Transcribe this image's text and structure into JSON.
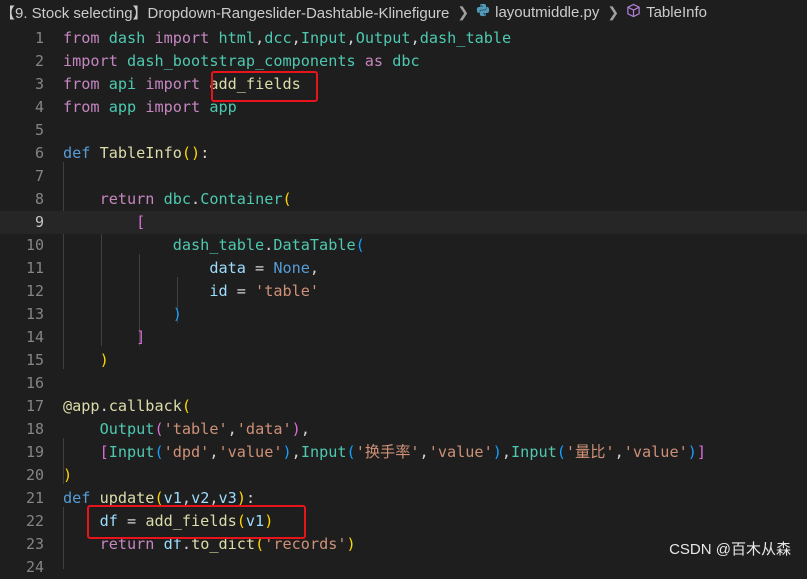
{
  "breadcrumb": {
    "folder": "【9. Stock selecting】Dropdown-Rangeslider-Dashtable-Klinefigure",
    "file": "layoutmiddle.py",
    "symbol": "TableInfo",
    "folder_icon": "folder",
    "file_icon": "python-file-icon",
    "symbol_icon": "symbol-method-cube-icon"
  },
  "editor": {
    "active_line": 9,
    "lines": [
      {
        "n": "1",
        "tokens": [
          [
            "kw",
            "from"
          ],
          [
            "t",
            " "
          ],
          [
            "cls",
            "dash"
          ],
          [
            "t",
            " "
          ],
          [
            "kw",
            "import"
          ],
          [
            "t",
            " "
          ],
          [
            "cls",
            "html"
          ],
          [
            "t",
            ","
          ],
          [
            "cls",
            "dcc"
          ],
          [
            "t",
            ","
          ],
          [
            "cls",
            "Input"
          ],
          [
            "t",
            ","
          ],
          [
            "cls",
            "Output"
          ],
          [
            "t",
            ","
          ],
          [
            "cls",
            "dash_table"
          ]
        ]
      },
      {
        "n": "2",
        "tokens": [
          [
            "kw",
            "import"
          ],
          [
            "t",
            " "
          ],
          [
            "cls",
            "dash_bootstrap_components"
          ],
          [
            "t",
            " "
          ],
          [
            "kw",
            "as"
          ],
          [
            "t",
            " "
          ],
          [
            "cls",
            "dbc"
          ]
        ]
      },
      {
        "n": "3",
        "tokens": [
          [
            "kw",
            "from"
          ],
          [
            "t",
            " "
          ],
          [
            "cls",
            "api"
          ],
          [
            "t",
            " "
          ],
          [
            "kw",
            "import"
          ],
          [
            "t",
            " "
          ],
          [
            "fn",
            "add_fields"
          ]
        ]
      },
      {
        "n": "4",
        "tokens": [
          [
            "kw",
            "from"
          ],
          [
            "t",
            " "
          ],
          [
            "cls",
            "app"
          ],
          [
            "t",
            " "
          ],
          [
            "kw",
            "import"
          ],
          [
            "t",
            " "
          ],
          [
            "cls",
            "app"
          ]
        ]
      },
      {
        "n": "5",
        "tokens": []
      },
      {
        "n": "6",
        "tokens": [
          [
            "kwb",
            "def"
          ],
          [
            "t",
            " "
          ],
          [
            "fn",
            "TableInfo"
          ],
          [
            "p1",
            "()"
          ],
          [
            "t",
            ":"
          ]
        ]
      },
      {
        "n": "7",
        "tokens": []
      },
      {
        "n": "8",
        "tokens": [
          [
            "t",
            "    "
          ],
          [
            "kw",
            "return"
          ],
          [
            "t",
            " "
          ],
          [
            "cls",
            "dbc"
          ],
          [
            "t",
            "."
          ],
          [
            "cls",
            "Container"
          ],
          [
            "p1",
            "("
          ]
        ]
      },
      {
        "n": "9",
        "tokens": [
          [
            "t",
            "        "
          ],
          [
            "p2",
            "["
          ]
        ]
      },
      {
        "n": "10",
        "tokens": [
          [
            "t",
            "            "
          ],
          [
            "cls",
            "dash_table"
          ],
          [
            "t",
            "."
          ],
          [
            "cls",
            "DataTable"
          ],
          [
            "p3",
            "("
          ]
        ]
      },
      {
        "n": "11",
        "tokens": [
          [
            "t",
            "                "
          ],
          [
            "var",
            "data"
          ],
          [
            "t",
            " = "
          ],
          [
            "kwb",
            "None"
          ],
          [
            "t",
            ","
          ]
        ]
      },
      {
        "n": "12",
        "tokens": [
          [
            "t",
            "                "
          ],
          [
            "var",
            "id"
          ],
          [
            "t",
            " = "
          ],
          [
            "str",
            "'table'"
          ]
        ]
      },
      {
        "n": "13",
        "tokens": [
          [
            "t",
            "            "
          ],
          [
            "p3",
            ")"
          ]
        ]
      },
      {
        "n": "14",
        "tokens": [
          [
            "t",
            "        "
          ],
          [
            "p2",
            "]"
          ]
        ]
      },
      {
        "n": "15",
        "tokens": [
          [
            "t",
            "    "
          ],
          [
            "p1",
            ")"
          ]
        ]
      },
      {
        "n": "16",
        "tokens": []
      },
      {
        "n": "17",
        "tokens": [
          [
            "fn",
            "@app"
          ],
          [
            "t",
            "."
          ],
          [
            "fn",
            "callback"
          ],
          [
            "p1",
            "("
          ]
        ]
      },
      {
        "n": "18",
        "tokens": [
          [
            "t",
            "    "
          ],
          [
            "cls",
            "Output"
          ],
          [
            "p2",
            "("
          ],
          [
            "str",
            "'table'"
          ],
          [
            "t",
            ","
          ],
          [
            "str",
            "'data'"
          ],
          [
            "p2",
            ")"
          ],
          [
            "t",
            ","
          ]
        ]
      },
      {
        "n": "19",
        "tokens": [
          [
            "t",
            "    "
          ],
          [
            "p2",
            "["
          ],
          [
            "cls",
            "Input"
          ],
          [
            "p3",
            "("
          ],
          [
            "str",
            "'dpd'"
          ],
          [
            "t",
            ","
          ],
          [
            "str",
            "'value'"
          ],
          [
            "p3",
            ")"
          ],
          [
            "t",
            ","
          ],
          [
            "cls",
            "Input"
          ],
          [
            "p3",
            "("
          ],
          [
            "str",
            "'换手率'"
          ],
          [
            "t",
            ","
          ],
          [
            "str",
            "'value'"
          ],
          [
            "p3",
            ")"
          ],
          [
            "t",
            ","
          ],
          [
            "cls",
            "Input"
          ],
          [
            "p3",
            "("
          ],
          [
            "str",
            "'量比'"
          ],
          [
            "t",
            ","
          ],
          [
            "str",
            "'value'"
          ],
          [
            "p3",
            ")"
          ],
          [
            "p2",
            "]"
          ]
        ]
      },
      {
        "n": "20",
        "tokens": [
          [
            "p1",
            ")"
          ]
        ]
      },
      {
        "n": "21",
        "tokens": [
          [
            "kwb",
            "def"
          ],
          [
            "t",
            " "
          ],
          [
            "fn",
            "update"
          ],
          [
            "p1",
            "("
          ],
          [
            "var",
            "v1"
          ],
          [
            "t",
            ","
          ],
          [
            "var",
            "v2"
          ],
          [
            "t",
            ","
          ],
          [
            "var",
            "v3"
          ],
          [
            "p1",
            ")"
          ],
          [
            "t",
            ":"
          ]
        ]
      },
      {
        "n": "22",
        "tokens": [
          [
            "t",
            "    "
          ],
          [
            "var",
            "df"
          ],
          [
            "t",
            " = "
          ],
          [
            "fn",
            "add_fields"
          ],
          [
            "p1",
            "("
          ],
          [
            "var",
            "v1"
          ],
          [
            "p1",
            ")"
          ]
        ]
      },
      {
        "n": "23",
        "tokens": [
          [
            "t",
            "    "
          ],
          [
            "kw",
            "return"
          ],
          [
            "t",
            " "
          ],
          [
            "var",
            "df"
          ],
          [
            "t",
            "."
          ],
          [
            "fn",
            "to_dict"
          ],
          [
            "p1",
            "("
          ],
          [
            "str",
            "'records'"
          ],
          [
            "p1",
            ")"
          ]
        ]
      },
      {
        "n": "24",
        "tokens": []
      }
    ]
  },
  "watermark": "CSDN @百木从森",
  "colors": {
    "background": "#1e1e1e",
    "keyword_control": "#c586c0",
    "keyword": "#569cd6",
    "function": "#dcdcaa",
    "class": "#4ec9b0",
    "variable": "#9cdcfe",
    "string": "#ce9178",
    "highlight_box": "#e8141b"
  }
}
